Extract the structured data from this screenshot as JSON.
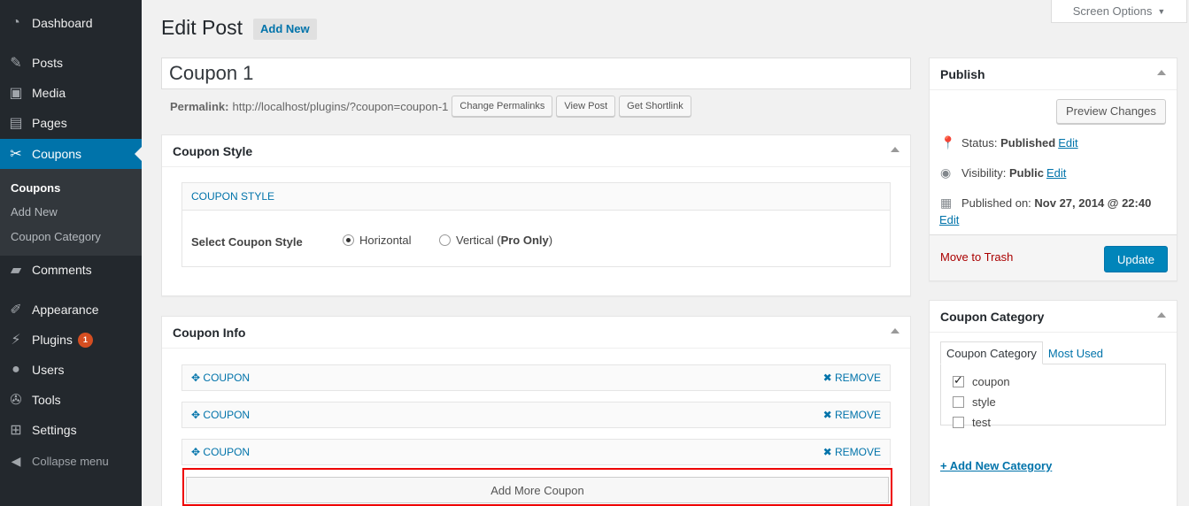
{
  "sidebar": {
    "items": [
      {
        "label": "Dashboard",
        "icon": "dashboard-icon",
        "glyph": "◔"
      },
      {
        "label": "Posts",
        "icon": "pin-icon",
        "glyph": "✎"
      },
      {
        "label": "Media",
        "icon": "media-icon",
        "glyph": "▣"
      },
      {
        "label": "Pages",
        "icon": "pages-icon",
        "glyph": "▤"
      },
      {
        "label": "Coupons",
        "icon": "coupon-icon",
        "glyph": "✂"
      },
      {
        "label": "Comments",
        "icon": "comment-icon",
        "glyph": "▰"
      },
      {
        "label": "Appearance",
        "icon": "brush-icon",
        "glyph": "✐"
      },
      {
        "label": "Plugins",
        "icon": "plugin-icon",
        "glyph": "⚡",
        "badge": "1"
      },
      {
        "label": "Users",
        "icon": "user-icon",
        "glyph": "●"
      },
      {
        "label": "Tools",
        "icon": "wrench-icon",
        "glyph": "✇"
      },
      {
        "label": "Settings",
        "icon": "settings-icon",
        "glyph": "⊞"
      }
    ],
    "submenu": [
      "Coupons",
      "Add New",
      "Coupon Category"
    ],
    "collapse_label": "Collapse menu"
  },
  "header": {
    "title": "Edit Post",
    "add_new": "Add New",
    "screen_options": "Screen Options"
  },
  "post": {
    "title": "Coupon 1",
    "permalink_label": "Permalink:",
    "permalink_url": "http://localhost/plugins/?coupon=coupon-1",
    "buttons": [
      "Change Permalinks",
      "View Post",
      "Get Shortlink"
    ]
  },
  "coupon_style": {
    "box_title": "Coupon Style",
    "inner_title": "COUPON STYLE",
    "field_label": "Select Coupon Style",
    "option_horizontal": "Horizontal",
    "option_vertical_prefix": "Vertical (",
    "option_vertical_bold": "Pro Only",
    "option_vertical_suffix": ")"
  },
  "coupon_info": {
    "box_title": "Coupon Info",
    "rows": [
      {
        "label": "COUPON",
        "remove": "REMOVE"
      },
      {
        "label": "COUPON",
        "remove": "REMOVE"
      },
      {
        "label": "COUPON",
        "remove": "REMOVE"
      }
    ],
    "add_more": "Add More Coupon"
  },
  "publish": {
    "title": "Publish",
    "preview": "Preview Changes",
    "status_label": "Status:",
    "status_value": "Published",
    "visibility_label": "Visibility:",
    "visibility_value": "Public",
    "published_label": "Published on:",
    "published_value": "Nov 27, 2014 @ 22:40",
    "edit": "Edit",
    "trash": "Move to Trash",
    "update": "Update"
  },
  "category": {
    "title": "Coupon Category",
    "tab_all": "Coupon Category",
    "tab_used": "Most Used",
    "items": [
      {
        "label": "coupon",
        "checked": true
      },
      {
        "label": "style",
        "checked": false
      },
      {
        "label": "test",
        "checked": false
      }
    ],
    "add_new": "+ Add New Category"
  },
  "colors": {
    "accent": "#0073aa",
    "highlight": "#dd0000",
    "sidebar": "#23282d"
  }
}
